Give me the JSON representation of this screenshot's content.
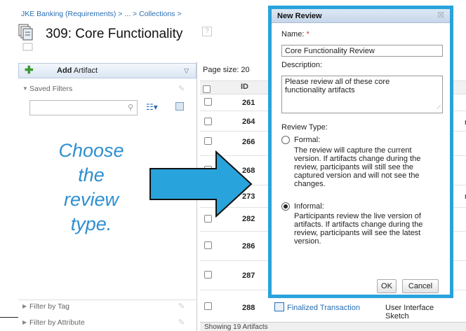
{
  "breadcrumb": "JKE Banking (Requirements) > ... > Collections >",
  "page": {
    "title": "309:  Core Functionality",
    "help": "?"
  },
  "left": {
    "add_button": {
      "bold": "Add",
      "rest": " Artifact"
    },
    "saved_filters": "Saved Filters",
    "filter_by_tag": "Filter by Tag",
    "filter_by_attribute": "Filter by Attribute"
  },
  "callout": {
    "line1": "Choose",
    "line2": "the",
    "line3": "review",
    "line4": "type."
  },
  "table": {
    "page_size_label": "Page size:  20",
    "id_header": "ID",
    "rows": [
      {
        "id": "261"
      },
      {
        "id": "264"
      },
      {
        "id": "266"
      },
      {
        "id": "268"
      },
      {
        "id": "273"
      },
      {
        "id": "282"
      },
      {
        "id": "286"
      },
      {
        "id": "287"
      },
      {
        "id": "288",
        "name": "Finalized Transaction",
        "type1": "User Interface",
        "type2": "Sketch"
      }
    ],
    "cut_letter": "r",
    "status": "Showing 19 Artifacts"
  },
  "dialog": {
    "title": "New Review",
    "close": "☒",
    "name_label": "Name:",
    "name_required": "*",
    "name_value": "Core Functionality Review",
    "description_label": "Description:",
    "description_line1": "Please review all of these core",
    "description_line2": "functionality artifacts",
    "review_type_label": "Review Type:",
    "formal": {
      "label": "Formal:",
      "d1": "The review will capture the current",
      "d2": "version. If artifacts change during the",
      "d3": "review, participants will still see the",
      "d4": "captured version and will not see the",
      "d5": "changes."
    },
    "informal": {
      "label": "Informal:",
      "d1": "Participants review the live version of",
      "d2": "artifacts. If artifacts change during the",
      "d3": "review, participants will see the latest",
      "d4": "version."
    },
    "selected_type": "informal",
    "ok": "OK",
    "cancel": "Cancel"
  },
  "colors": {
    "accent": "#29a3dc",
    "link": "#2a6db2",
    "callout": "#2e8fd0"
  },
  "icons": [
    "collection-icon",
    "help-icon",
    "plus-icon",
    "search-icon",
    "sort-icon",
    "save-icon",
    "edit-icon",
    "close-icon",
    "artifact-icon",
    "arrow"
  ]
}
